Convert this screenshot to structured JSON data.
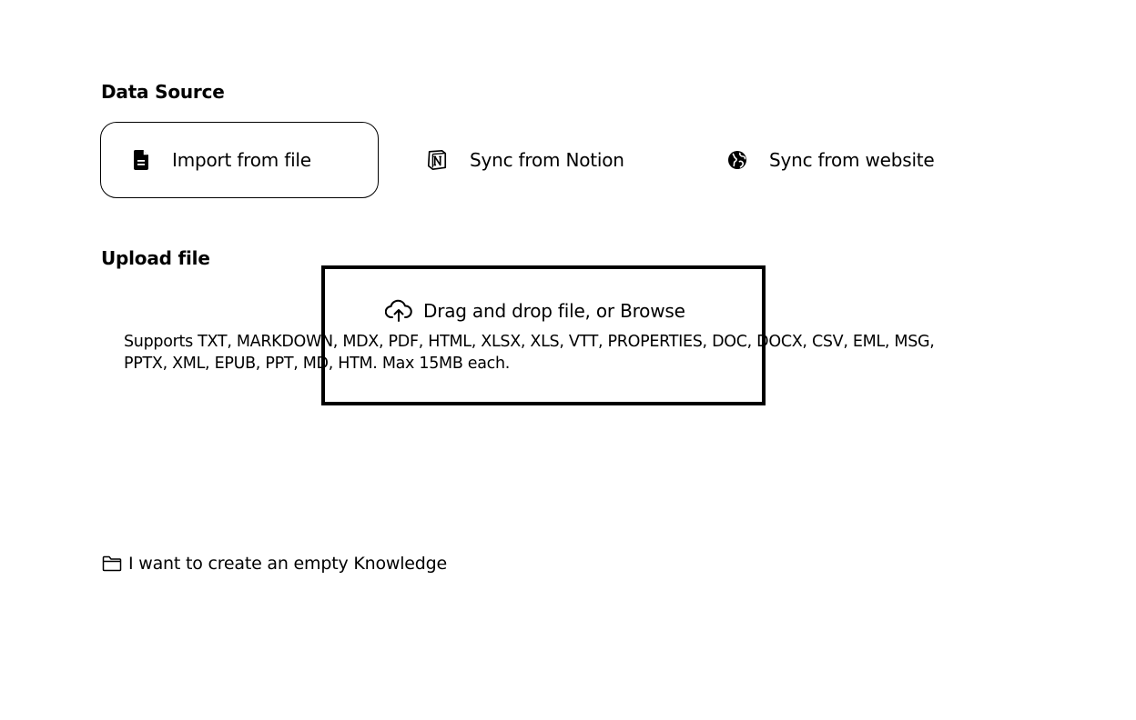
{
  "data_source": {
    "title": "Data Source",
    "options": [
      {
        "label": "Import from file",
        "icon": "file-icon",
        "selected": true
      },
      {
        "label": "Sync from Notion",
        "icon": "notion-icon",
        "selected": false
      },
      {
        "label": "Sync from website",
        "icon": "globe-icon",
        "selected": false
      }
    ]
  },
  "upload": {
    "title": "Upload file",
    "drop_label": "Drag and drop file, or Browse",
    "drop_icon": "cloud-upload-icon",
    "supports_text": "Supports TXT, MARKDOWN, MDX, PDF, HTML, XLSX, XLS, VTT, PROPERTIES, DOC, DOCX, CSV, EML, MSG, PPTX, XML, EPUB, PPT, MD, HTM. Max 15MB each."
  },
  "empty_knowledge": {
    "label": "I want to create an empty Knowledge",
    "icon": "folder-icon"
  },
  "colors": {
    "text": "#000000",
    "background": "#ffffff",
    "border": "#000000"
  }
}
